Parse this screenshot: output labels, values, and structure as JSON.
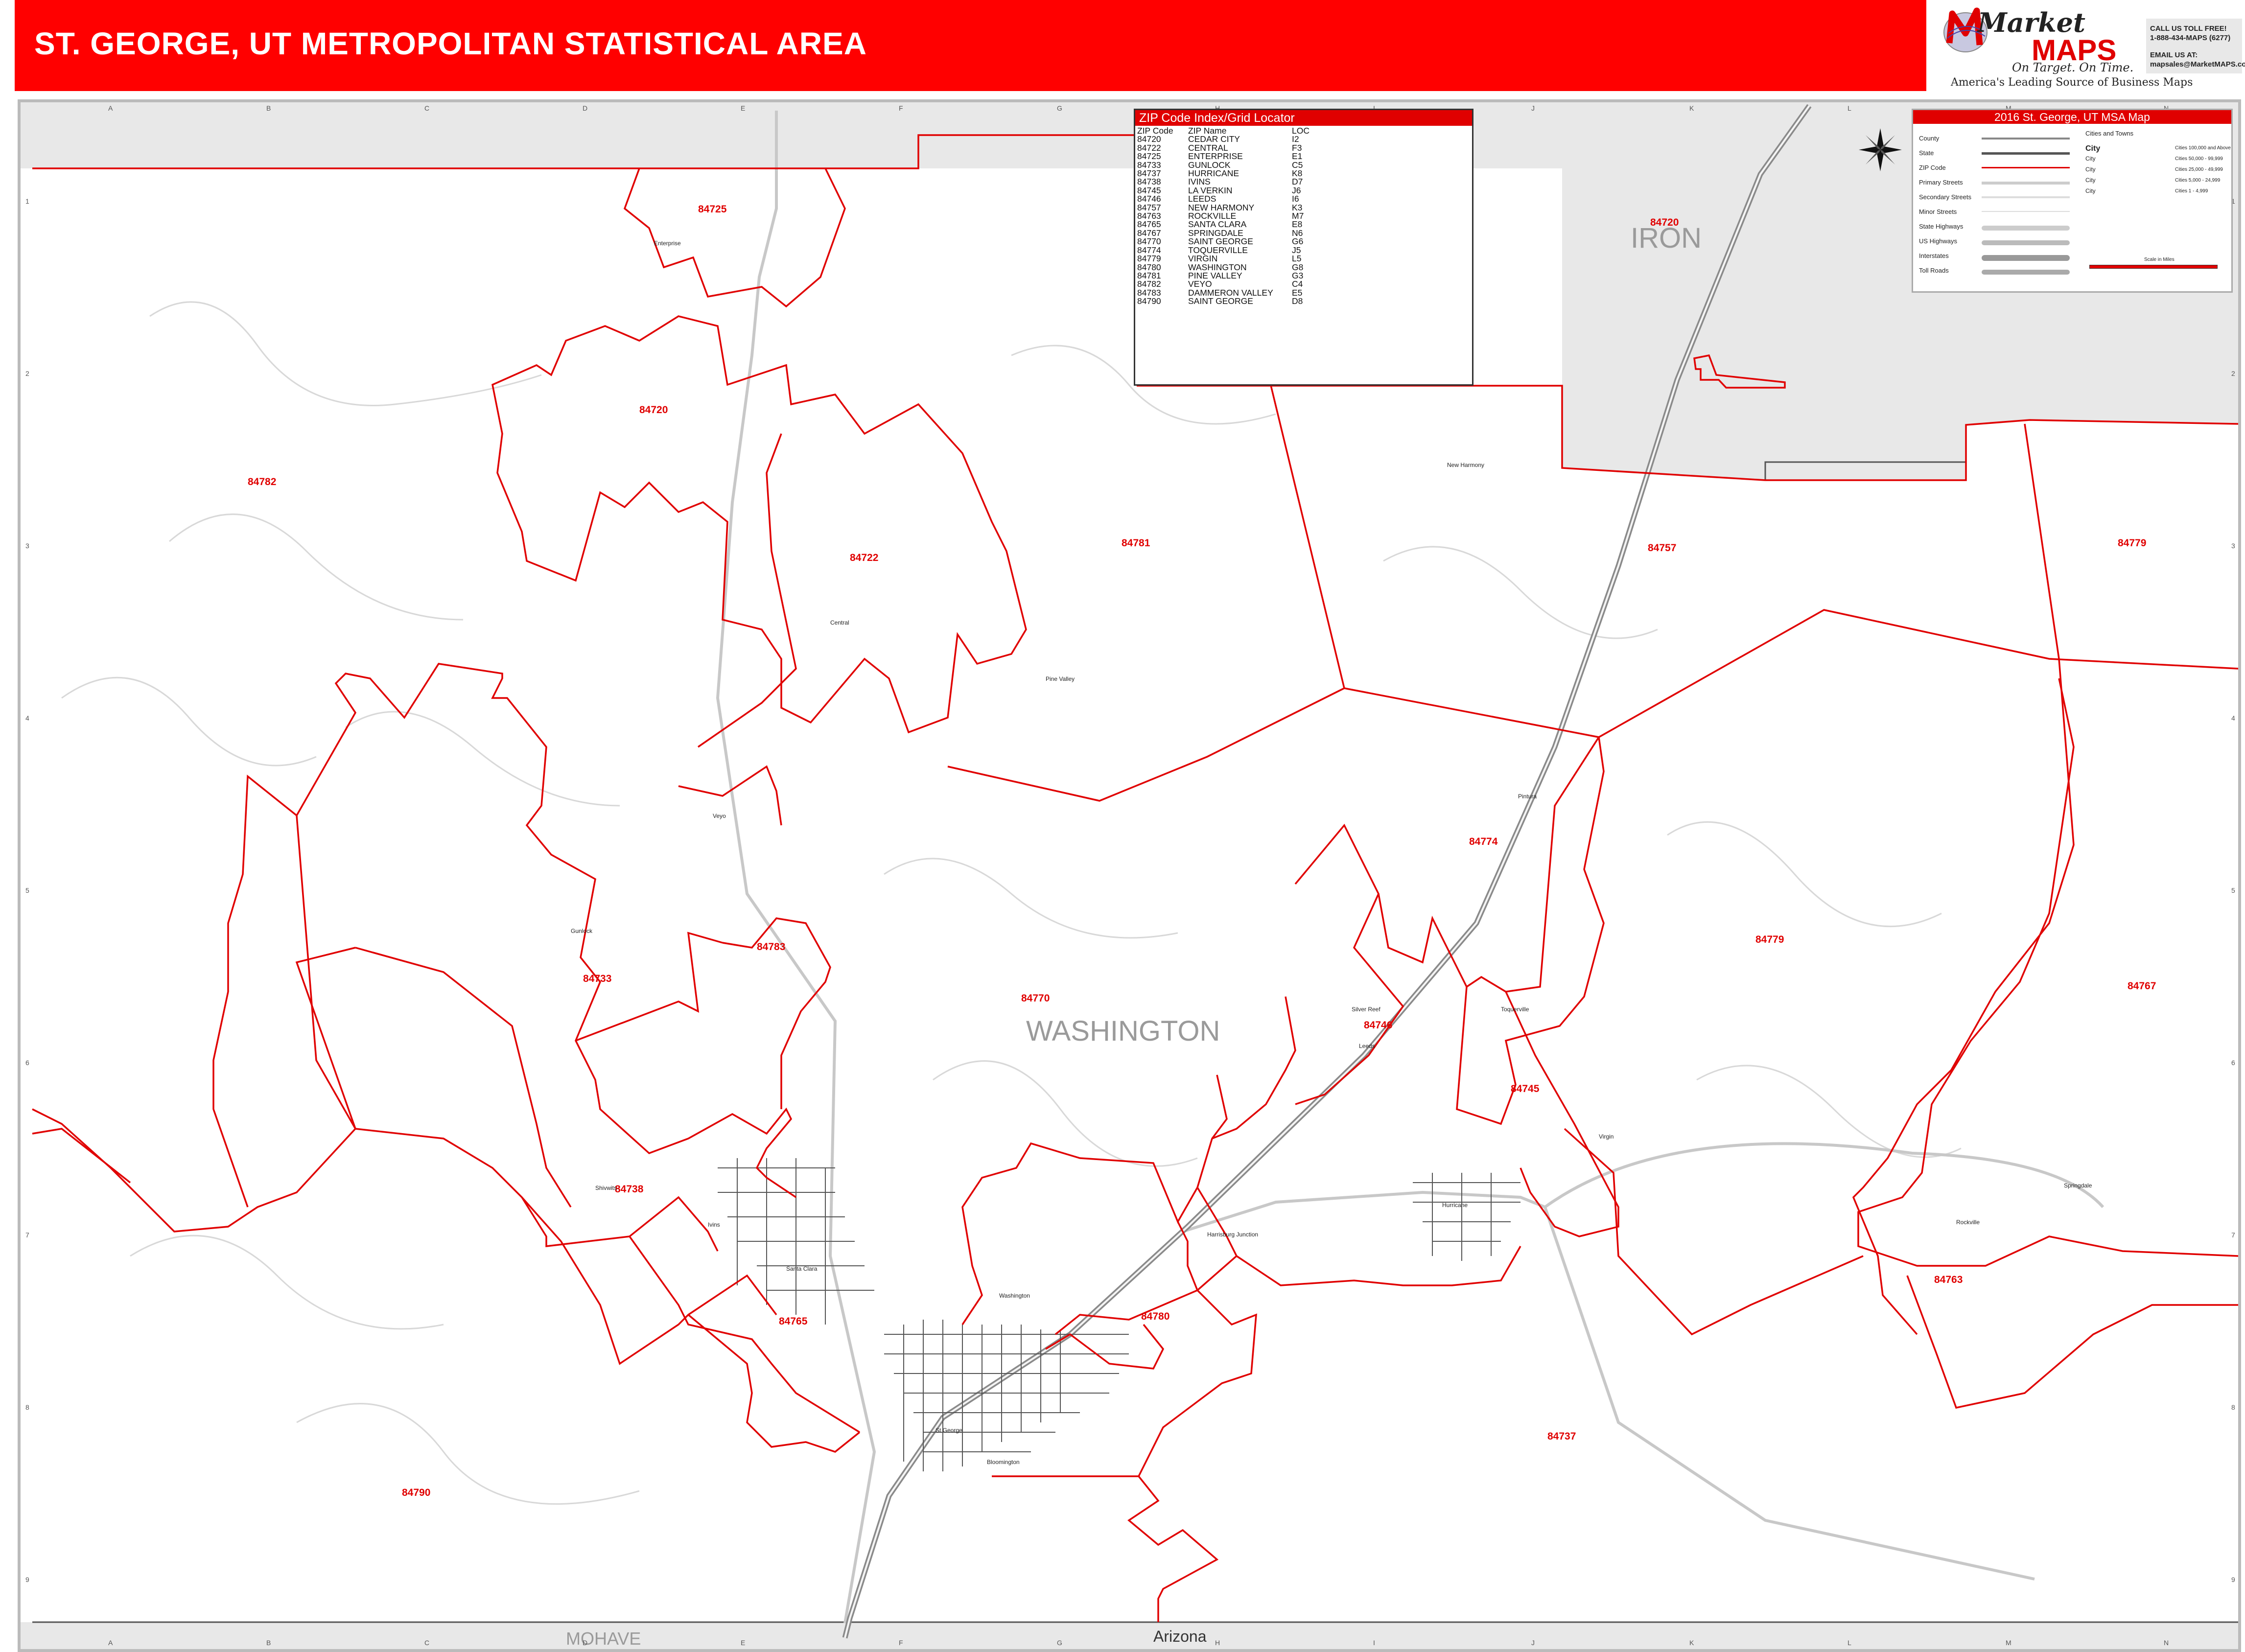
{
  "title": "ST. GEORGE, UT METROPOLITAN STATISTICAL AREA",
  "publisher": {
    "logo_word1": "Market",
    "logo_word2": "MAPS",
    "tagline": "On Target. On Time.",
    "subtitle": "America's Leading Source of Business Maps",
    "contact_lines": [
      "CALL US TOLL FREE!",
      "1-888-434-MAPS (6277)",
      "",
      "EMAIL US AT:",
      "mapsales@MarketMAPS.com"
    ]
  },
  "colors": {
    "accent": "#ff0000",
    "zip_boundary": "#e00000",
    "county_fill": "#e8e8e8",
    "roads": "#c8c8c8",
    "interstate": "#a0a0a0"
  },
  "grid": {
    "columns": [
      "A",
      "B",
      "C",
      "D",
      "E",
      "F",
      "G",
      "H",
      "I",
      "J",
      "K",
      "L",
      "M",
      "N"
    ],
    "rows": [
      "1",
      "2",
      "3",
      "4",
      "5",
      "6",
      "7",
      "8",
      "9"
    ]
  },
  "counties": {
    "iron": "IRON",
    "washington": "WASHINGTON",
    "mohave": "MOHAVE",
    "arizona": "Arizona"
  },
  "zip_index": {
    "title": "ZIP Code Index/Grid Locator",
    "headers": [
      "ZIP Code",
      "ZIP Name",
      "LOC"
    ],
    "rows": [
      [
        "84720",
        "CEDAR CITY",
        "I2"
      ],
      [
        "84722",
        "CENTRAL",
        "F3"
      ],
      [
        "84725",
        "ENTERPRISE",
        "E1"
      ],
      [
        "84733",
        "GUNLOCK",
        "C5"
      ],
      [
        "84737",
        "HURRICANE",
        "K8"
      ],
      [
        "84738",
        "IVINS",
        "D7"
      ],
      [
        "84745",
        "LA VERKIN",
        "J6"
      ],
      [
        "84746",
        "LEEDS",
        "I6"
      ],
      [
        "84757",
        "NEW HARMONY",
        "K3"
      ],
      [
        "84763",
        "ROCKVILLE",
        "M7"
      ],
      [
        "84765",
        "SANTA CLARA",
        "E8"
      ],
      [
        "84767",
        "SPRINGDALE",
        "N6"
      ],
      [
        "84770",
        "SAINT GEORGE",
        "G6"
      ],
      [
        "84774",
        "TOQUERVILLE",
        "J5"
      ],
      [
        "84779",
        "VIRGIN",
        "L5"
      ],
      [
        "84780",
        "WASHINGTON",
        "G8"
      ],
      [
        "84781",
        "PINE VALLEY",
        "G3"
      ],
      [
        "84782",
        "VEYO",
        "C4"
      ],
      [
        "84783",
        "DAMMERON VALLEY",
        "E5"
      ],
      [
        "84790",
        "SAINT GEORGE",
        "D8"
      ]
    ]
  },
  "legend": {
    "title": "2016 St. George, UT MSA Map",
    "items": [
      "County",
      "State",
      "ZIP Code",
      "Primary Streets",
      "Secondary Streets",
      "Minor Streets",
      "State Highways",
      "US Highways",
      "Interstates",
      "Toll Roads"
    ],
    "cities_header": "Cities and Towns",
    "cities": [
      [
        "City",
        "Cities 100,000 and Above"
      ],
      [
        "City",
        "Cities 50,000 - 99,999"
      ],
      [
        "City",
        "Cities 25,000 - 49,999"
      ],
      [
        "City",
        "Cities 5,000 - 24,999"
      ],
      [
        "City",
        "Cities 1 - 4,999"
      ]
    ],
    "scale_label": "Scale in Miles"
  },
  "zip_labels": [
    {
      "zip": "84725"
    },
    {
      "zip": "84720"
    },
    {
      "zip": "84720"
    },
    {
      "zip": "84782"
    },
    {
      "zip": "84722"
    },
    {
      "zip": "84781"
    },
    {
      "zip": "84757"
    },
    {
      "zip": "84779"
    },
    {
      "zip": "84774"
    },
    {
      "zip": "84733"
    },
    {
      "zip": "84783"
    },
    {
      "zip": "84770"
    },
    {
      "zip": "84746"
    },
    {
      "zip": "84779"
    },
    {
      "zip": "84767"
    },
    {
      "zip": "84745"
    },
    {
      "zip": "84738"
    },
    {
      "zip": "84765"
    },
    {
      "zip": "84780"
    },
    {
      "zip": "84763"
    },
    {
      "zip": "84737"
    },
    {
      "zip": "84790"
    }
  ],
  "towns": [
    "Enterprise",
    "New Harmony",
    "Central",
    "Pine Valley",
    "Veyo",
    "Pintura",
    "Gunlock",
    "Silver Reef",
    "Leeds",
    "Toquerville",
    "Springdale",
    "Rockville",
    "Shivwits",
    "Santa Clara",
    "Ivins",
    "Washington",
    "St George",
    "Hurricane",
    "Harrisburg Junction",
    "Virgin",
    "Bloomington"
  ]
}
